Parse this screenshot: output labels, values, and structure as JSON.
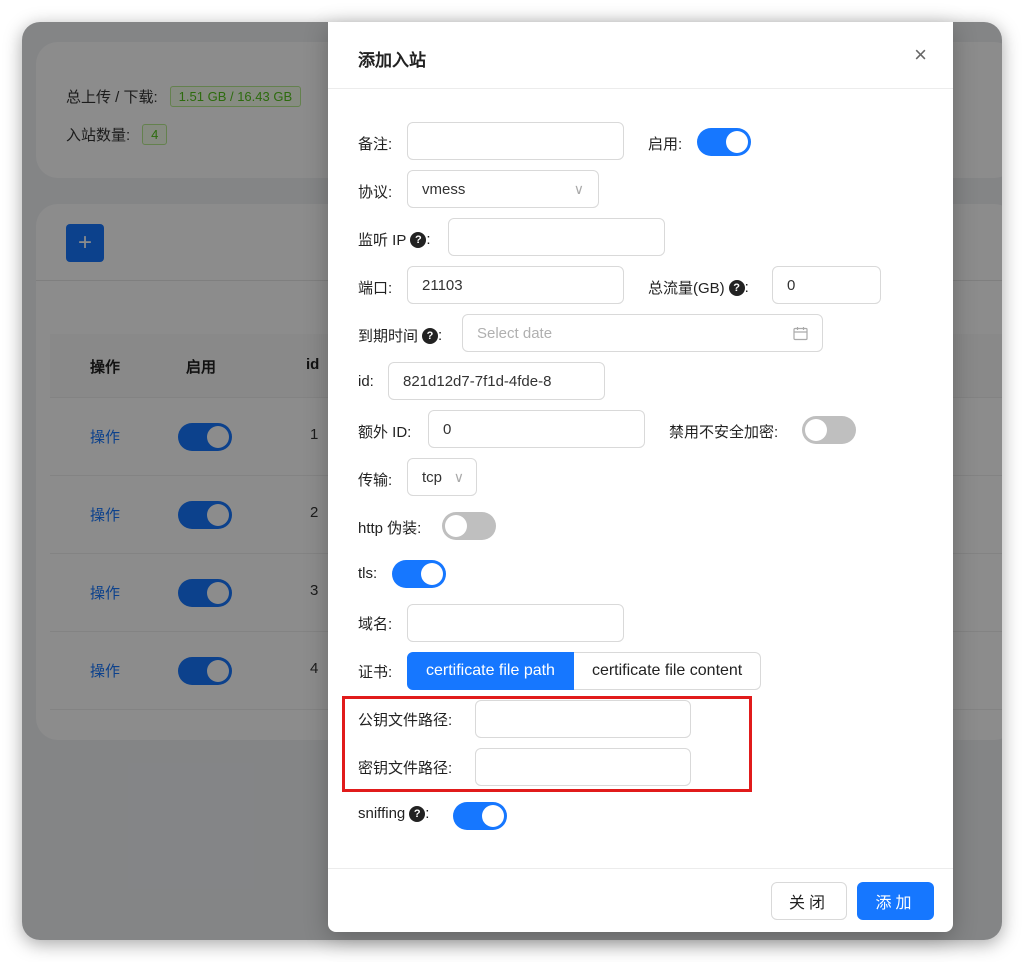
{
  "background": {
    "stats": {
      "upload_label": "总上传 / 下载:",
      "upload_value": "1.51 GB / 16.43 GB",
      "inbound_label": "入站数量:",
      "inbound_value": "4"
    },
    "add_button_label": "+",
    "table": {
      "headers": [
        "操作",
        "启用",
        "id"
      ],
      "rows": [
        {
          "action": "操作",
          "enabled": true,
          "id": "1"
        },
        {
          "action": "操作",
          "enabled": true,
          "id": "2"
        },
        {
          "action": "操作",
          "enabled": true,
          "id": "3"
        },
        {
          "action": "操作",
          "enabled": true,
          "id": "4"
        }
      ]
    }
  },
  "modal": {
    "title": "添加入站",
    "close_icon": "×",
    "fields": {
      "remark_label": "备注:",
      "remark_value": "",
      "enable_label": "启用:",
      "enable_on": true,
      "protocol_label": "协议:",
      "protocol_value": "vmess",
      "listen_ip_label": "监听 IP",
      "listen_ip_value": "",
      "port_label": "端口:",
      "port_value": "21103",
      "total_traffic_label": "总流量(GB)",
      "total_traffic_value": "0",
      "expiry_label": "到期时间",
      "expiry_placeholder": "Select date",
      "id_label": "id:",
      "id_value": "821d12d7-7f1d-4fde-8",
      "alter_id_label": "额外 ID:",
      "alter_id_value": "0",
      "disable_insecure_label": "禁用不安全加密:",
      "disable_insecure_on": false,
      "transport_label": "传输:",
      "transport_value": "tcp",
      "http_disguise_label": "http 伪装:",
      "http_disguise_on": false,
      "tls_label": "tls:",
      "tls_on": true,
      "domain_label": "域名:",
      "domain_value": "",
      "cert_label": "证书:",
      "cert_options": [
        "certificate file path",
        "certificate file content"
      ],
      "cert_selected": "certificate file path",
      "public_key_path_label": "公钥文件路径:",
      "public_key_path_value": "",
      "private_key_path_label": "密钥文件路径:",
      "private_key_path_value": "",
      "sniffing_label": "sniffing",
      "sniffing_on": true
    },
    "footer": {
      "close_label": "关闭",
      "add_label": "添加"
    }
  },
  "colors": {
    "primary": "#1677ff",
    "highlight": "#e11b1b",
    "success": "#52c41a"
  }
}
